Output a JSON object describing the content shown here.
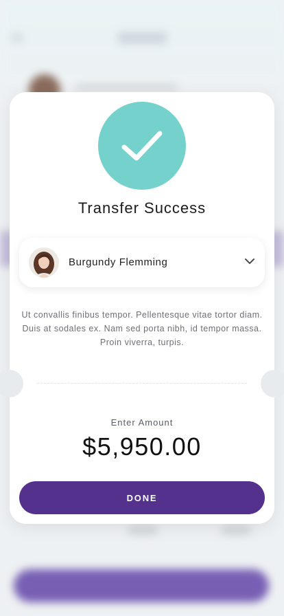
{
  "modal": {
    "title": "Transfer Success",
    "recipient": {
      "name": "Burgundy Flemming"
    },
    "description": "Ut convallis finibus tempor. Pellentesque vitae tortor diam. Duis at sodales ex. Nam sed porta nibh, id tempor massa. Proin viverra, turpis.",
    "amount_label": "Enter Amount",
    "amount_value": "$5,950.00",
    "done_label": "DONE"
  },
  "icons": {
    "success": "checkmark-icon",
    "dropdown": "chevron-down-icon"
  },
  "colors": {
    "success_circle": "#74d1cc",
    "primary_button": "#54318c",
    "background": "#eef1f3"
  }
}
